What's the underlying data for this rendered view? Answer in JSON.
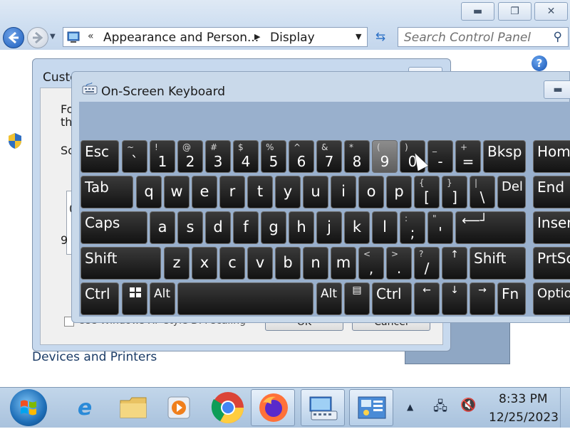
{
  "control_panel": {
    "address": {
      "separator": "«",
      "segment1": "Appearance and Person...",
      "segment2": "Display"
    },
    "search_placeholder": "Search Control Panel",
    "help_label": "?",
    "devices_link": "Devices and Printers"
  },
  "dpi_dialog": {
    "title": "Custo",
    "text_fo": "Fo",
    "text_th": "th",
    "text_sc": "Sc",
    "text_0": "0",
    "text_9": "9",
    "checkbox_label": "Use Windows XP style DPI scaling",
    "ok_label": "OK",
    "cancel_label": "Cancel"
  },
  "osk": {
    "title": "On-Screen Keyboard",
    "keys": {
      "esc": "Esc",
      "tick_top": "~",
      "tick_bot": "`",
      "k1_top": "!",
      "k1_bot": "1",
      "k2_top": "@",
      "k2_bot": "2",
      "k3_top": "#",
      "k3_bot": "3",
      "k4_top": "$",
      "k4_bot": "4",
      "k5_top": "%",
      "k5_bot": "5",
      "k6_top": "^",
      "k6_bot": "6",
      "k7_top": "&",
      "k7_bot": "7",
      "k8_top": "*",
      "k8_bot": "8",
      "k9_top": "(",
      "k9_bot": "9",
      "k0_top": ")",
      "k0_bot": "0",
      "minus_top": "_",
      "minus_bot": "-",
      "eq_top": "+",
      "eq_bot": "=",
      "bksp": "Bksp",
      "home": "Home",
      "tab": "Tab",
      "q": "q",
      "w": "w",
      "e": "e",
      "r": "r",
      "t": "t",
      "y": "y",
      "u": "u",
      "i": "i",
      "o": "o",
      "p": "p",
      "lbr_top": "{",
      "lbr_bot": "[",
      "rbr_top": "}",
      "rbr_bot": "]",
      "bs_top": "|",
      "bs_bot": "\\",
      "del": "Del",
      "end": "End",
      "caps": "Caps",
      "a": "a",
      "s": "s",
      "d": "d",
      "f": "f",
      "g": "g",
      "h": "h",
      "j": "j",
      "k": "k",
      "l": "l",
      "semi_top": ":",
      "semi_bot": ";",
      "quote_top": "\"",
      "quote_bot": "'",
      "insert": "Insert",
      "shift": "Shift",
      "z": "z",
      "x": "x",
      "c": "c",
      "v": "v",
      "b": "b",
      "n": "n",
      "m": "m",
      "comma_top": "<",
      "comma_bot": ",",
      "period_top": ">",
      "period_bot": ".",
      "slash_top": "?",
      "slash_bot": "/",
      "up": "↑",
      "shift_r": "Shift",
      "prtscn": "PrtScn",
      "ctrl": "Ctrl",
      "alt": "Alt",
      "alt_r": "Alt",
      "ctrl_r": "Ctrl",
      "left": "←",
      "down": "↓",
      "right": "→",
      "fn": "Fn",
      "options": "Options"
    }
  },
  "taskbar": {
    "time": "8:33 PM",
    "date": "12/25/2023"
  },
  "icons": {
    "back": "back-arrow-icon",
    "forward": "forward-arrow-icon",
    "search": "search-icon",
    "help": "help-icon",
    "shield": "uac-shield-icon",
    "windows": "windows-logo-icon",
    "menu": "context-menu-icon",
    "enter": "enter-icon"
  },
  "colors": {
    "key_bg": "#1c1c1c",
    "key_highlight": "#7a7a7a",
    "osk_body": "#99b0cd",
    "window_frame": "#c9d9ea"
  }
}
